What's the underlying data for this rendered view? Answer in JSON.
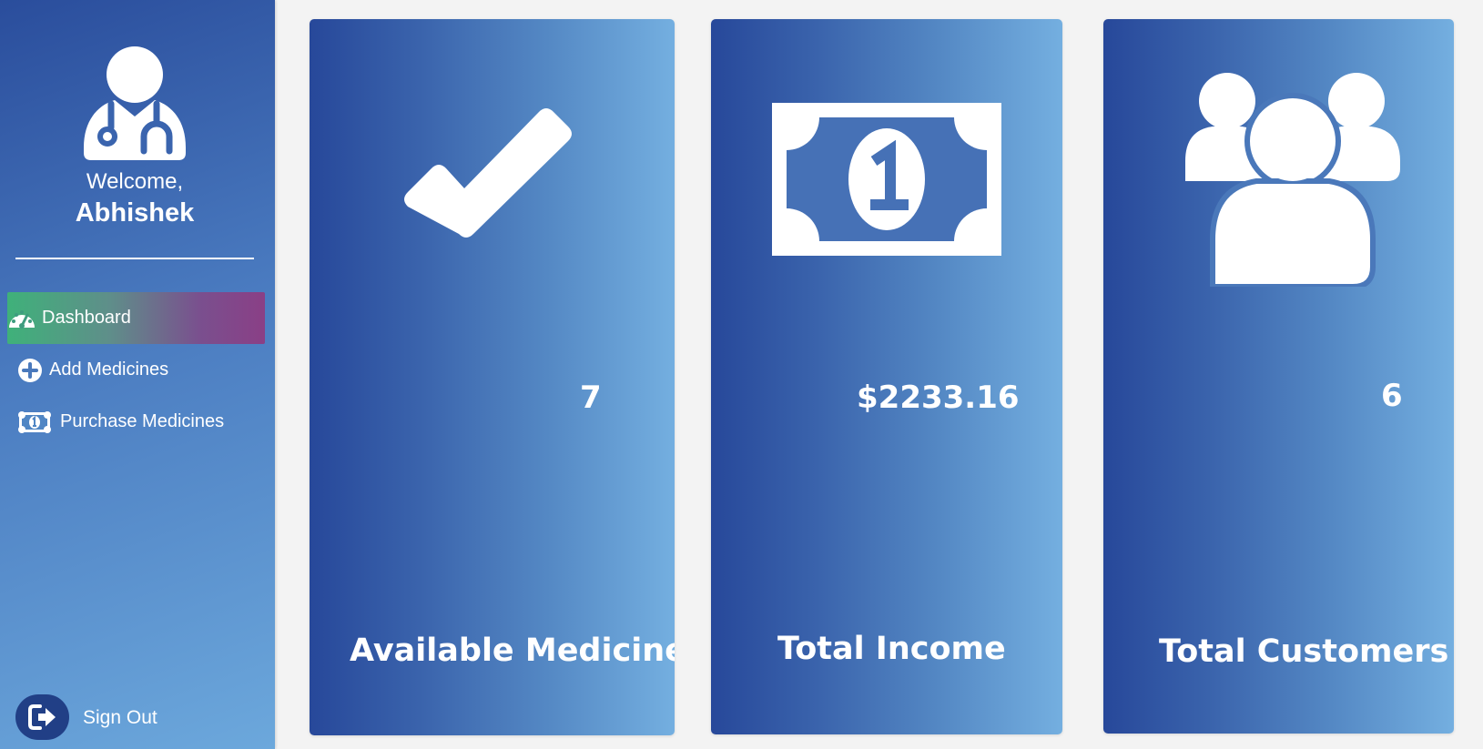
{
  "sidebar": {
    "welcome": "Welcome,",
    "username": "Abhishek",
    "avatar_icon": "doctor-icon",
    "nav": [
      {
        "label": "Dashboard",
        "icon": "dashboard-gauge-icon",
        "active": true
      },
      {
        "label": "Add Medicines",
        "icon": "plus-circle-icon",
        "active": false
      },
      {
        "label": "Purchase Medicines",
        "icon": "money-bill-icon",
        "active": false
      }
    ],
    "signout": {
      "label": "Sign Out",
      "icon": "sign-out-icon"
    }
  },
  "cards": [
    {
      "value": "7",
      "label": "Available Medicines",
      "icon": "checkmark-icon"
    },
    {
      "value": "$2233.16",
      "label": "Total Income",
      "icon": "money-bill-icon"
    },
    {
      "value": "6",
      "label": "Total Customers",
      "icon": "users-icon"
    }
  ],
  "colors": {
    "sidebar_top": "#2a4d9c",
    "sidebar_bottom": "#6ca8dc",
    "active_start": "#3fb17a",
    "active_end": "#8a3f86",
    "card_start": "#27489a",
    "card_end": "#74afe0",
    "background": "#f3f3f3"
  }
}
